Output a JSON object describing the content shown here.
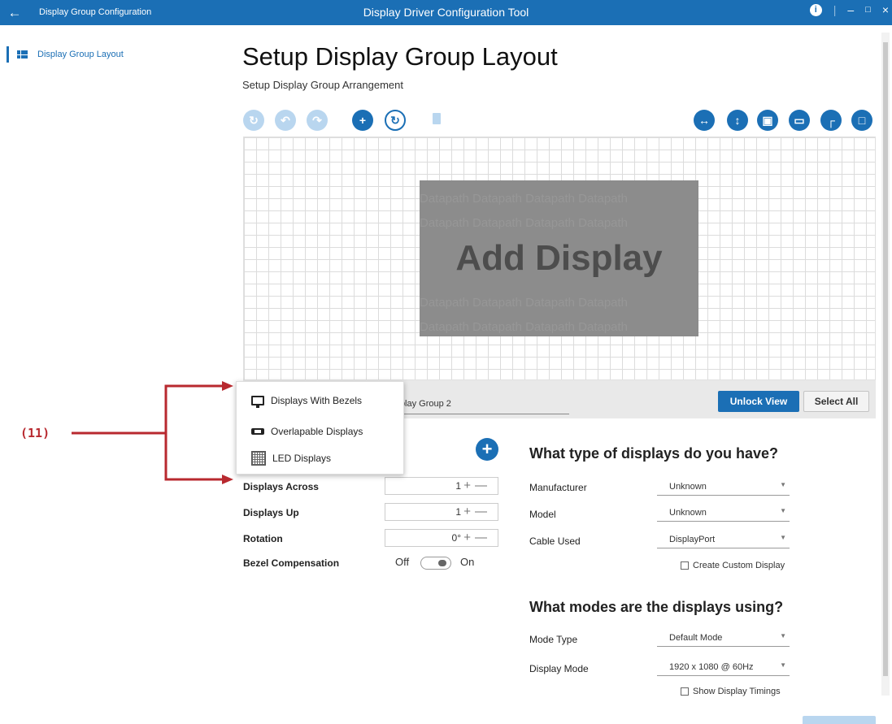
{
  "window": {
    "title": "Display Group Configuration",
    "app_title": "Display Driver Configuration Tool",
    "info_label": "i",
    "minimize": "–",
    "maximize": "□",
    "close": "×",
    "back": "←"
  },
  "sidebar": {
    "items": [
      {
        "label": "Display Group Layout",
        "icon": "grid-layout-icon"
      }
    ]
  },
  "main": {
    "title": "Setup Display Group Layout",
    "subtitle": "Setup Display Group Arrangement"
  },
  "toolbar": {
    "left_icons": [
      "history-icon",
      "undo-icon",
      "redo-icon",
      "move-icon",
      "rotate-icon",
      "delete-icon"
    ],
    "right_icons": [
      "fit-horizontal-icon",
      "fit-vertical-icon",
      "fit-all-icon",
      "display-icon",
      "corner-icon",
      "fullscreen-icon"
    ]
  },
  "canvas": {
    "placeholder_text": "Add Display",
    "watermark": "Datapath Datapath Datapath Datapath"
  },
  "group": {
    "name": "isplay Group 2",
    "unlock_label": "Unlock View",
    "select_all_label": "Select All"
  },
  "popup": {
    "items": [
      {
        "label": "Displays With Bezels",
        "icon": "monitor-icon"
      },
      {
        "label": "Overlapable Displays",
        "icon": "overlap-icon"
      },
      {
        "label": "LED Displays",
        "icon": "led-grid-icon"
      }
    ]
  },
  "annotation": {
    "label": "(11)",
    "color": "#b8292f"
  },
  "layout_form": {
    "displays_across_label": "Displays Across",
    "displays_across_value": "1",
    "displays_up_label": "Displays Up",
    "displays_up_value": "1",
    "rotation_label": "Rotation",
    "rotation_value": "0°",
    "bezel_label": "Bezel Compensation",
    "bezel_off": "Off",
    "bezel_on": "On",
    "bezel_state": false,
    "stepper_controls": "+—"
  },
  "display_type": {
    "heading": "What type of displays do you have?",
    "manufacturer_label": "Manufacturer",
    "manufacturer_value": "Unknown",
    "model_label": "Model",
    "model_value": "Unknown",
    "cable_label": "Cable Used",
    "cable_value": "DisplayPort",
    "custom_display_label": "Create Custom Display"
  },
  "display_modes": {
    "heading": "What modes are the displays using?",
    "mode_type_label": "Mode Type",
    "mode_type_value": "Default Mode",
    "display_mode_label": "Display Mode",
    "display_mode_value": "1920 x 1080 @ 60Hz",
    "show_timings_label": "Show Display Timings"
  },
  "colors": {
    "accent": "#1b6fb5",
    "accent_faded": "#b9d6ef",
    "annotation": "#b8292f"
  }
}
